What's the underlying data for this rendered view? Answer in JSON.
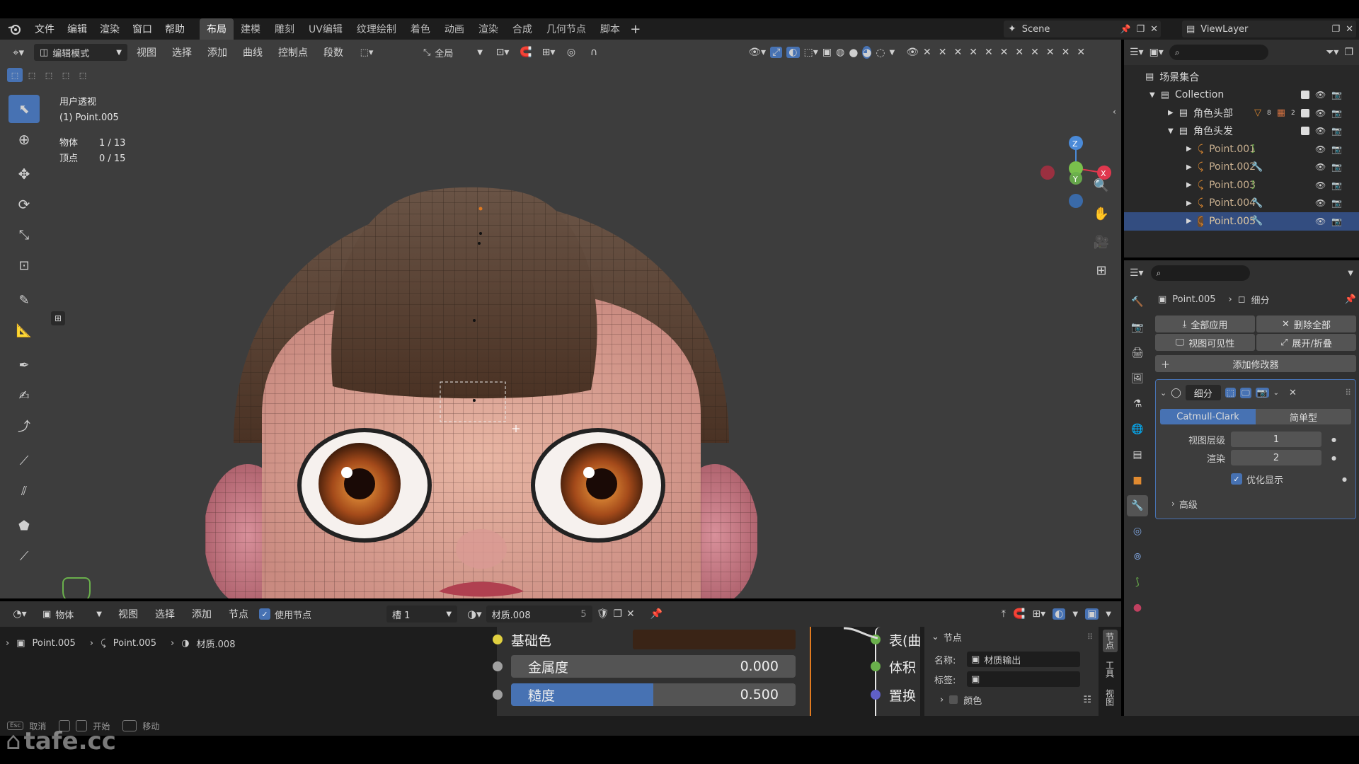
{
  "colors": {
    "accent": "#4772b3",
    "bg_dark": "#1d1d1d",
    "panel": "#303030",
    "header": "#242424",
    "viewport": "#3d3d3d"
  },
  "topbar": {
    "menus": [
      "文件",
      "编辑",
      "渲染",
      "窗口",
      "帮助"
    ],
    "tabs": [
      "布局",
      "建模",
      "雕刻",
      "UV编辑",
      "纹理绘制",
      "着色",
      "动画",
      "渲染",
      "合成",
      "几何节点",
      "脚本"
    ],
    "active_tab": "布局",
    "scene": "Scene",
    "view_layer": "ViewLayer"
  },
  "viewport_header": {
    "mode": "编辑模式",
    "menus": [
      "视图",
      "选择",
      "添加",
      "曲线",
      "控制点",
      "段数"
    ],
    "transform_orientation": "全局"
  },
  "viewport": {
    "view_name": "用户透视",
    "object_name": "(1) Point.005",
    "stats": [
      {
        "label": "物体",
        "value": "1 / 13"
      },
      {
        "label": "顶点",
        "value": "0 / 15"
      }
    ],
    "gizmo": {
      "z": "Z",
      "y": "Y",
      "x": "X"
    }
  },
  "outliner": {
    "title": "场景集合",
    "collection": "Collection",
    "items": [
      {
        "label": "角色头部",
        "level": 2
      },
      {
        "label": "角色头发",
        "level": 2
      },
      {
        "label": "Point.001",
        "level": 3
      },
      {
        "label": "Point.002",
        "level": 3
      },
      {
        "label": "Point.003",
        "level": 3
      },
      {
        "label": "Point.004",
        "level": 3
      },
      {
        "label": "Point.005",
        "level": 3
      }
    ],
    "badge_count": "8",
    "badge_count2": "2"
  },
  "properties": {
    "breadcrumb_object": "Point.005",
    "breadcrumb_modifier": "细分",
    "apply_all": "全部应用",
    "delete_all": "删除全部",
    "viewport_visibility": "视图可见性",
    "expand_collapse": "展开/折叠",
    "add_modifier": "添加修改器",
    "modifier_name": "细分",
    "algo_catmull": "Catmull-Clark",
    "algo_simple": "简单型",
    "levels_viewport_label": "视图层级",
    "levels_viewport": "1",
    "render_label": "渲染",
    "render_value": "2",
    "optimal_display": "优化显示",
    "advanced": "高级"
  },
  "shader_header": {
    "mode": "物体",
    "menus": [
      "视图",
      "选择",
      "添加",
      "节点"
    ],
    "use_nodes": "使用节点",
    "slot": "槽 1",
    "material": "材质.008",
    "user_count": "5"
  },
  "shader_breadcrumb": [
    "Point.005",
    "Point.005",
    "材质.008"
  ],
  "shader_node": {
    "base_color_label": "基础色",
    "metallic_label": "金属度",
    "metallic_value": "0.000",
    "roughness_label": "糙度",
    "roughness_value": "0.500",
    "roughness_fill": 0.5
  },
  "output_node": {
    "sockets": [
      "表(曲",
      "体积",
      "置换"
    ]
  },
  "node_sidebar": {
    "panel_title": "节点",
    "name_label": "名称:",
    "name_value": "材质输出",
    "label_label": "标签:",
    "color_label": "颜色",
    "tabs": [
      "节点",
      "工具",
      "视图"
    ]
  },
  "statusbar": {
    "items": [
      "取消",
      "开始",
      "移动"
    ]
  },
  "watermark": "tafe.cc"
}
